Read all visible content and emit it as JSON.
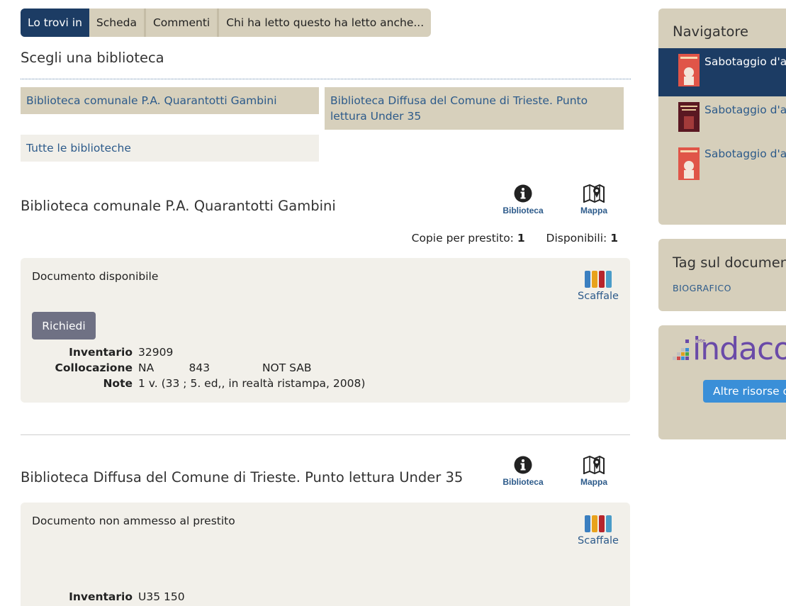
{
  "tabs": [
    {
      "label": "Lo trovi in",
      "active": true
    },
    {
      "label": "Scheda",
      "active": false
    },
    {
      "label": "Commenti",
      "active": false
    },
    {
      "label": "Chi ha letto questo ha letto anche...",
      "active": false
    }
  ],
  "choose_title": "Scegli una biblioteca",
  "library_buttons": [
    "Biblioteca comunale P.A. Quarantotti Gambini",
    "Biblioteca Diffusa del Comune di Trieste. Punto lettura Under 35",
    "Tutte le biblioteche"
  ],
  "icon_labels": {
    "library": "Biblioteca",
    "map": "Mappa",
    "shelf": "Scaffale"
  },
  "libraries": [
    {
      "name": "Biblioteca comunale P.A. Quarantotti Gambini",
      "copies_label": "Copie per prestito:",
      "copies_value": "1",
      "available_label": "Disponibili:",
      "available_value": "1",
      "status": "Documento disponibile",
      "request_label": "Richiedi",
      "details": [
        {
          "key": "Inventario",
          "value": "32909"
        },
        {
          "key": "Collocazione",
          "value": "NA          843               NOT SAB"
        },
        {
          "key": "Note",
          "value": "1 v. (33 ; 5. ed,, in realtà ristampa, 2008)"
        }
      ]
    },
    {
      "name": "Biblioteca Diffusa del Comune di Trieste. Punto lettura Under 35",
      "status": "Documento non ammesso al prestito",
      "details": [
        {
          "key": "Inventario",
          "value": "U35 150"
        }
      ]
    }
  ],
  "sidebar": {
    "navigator_title": "Navigatore",
    "navigator_items": [
      {
        "label": "Sabotaggio d'am",
        "active": true
      },
      {
        "label": "Sabotaggio d'am",
        "active": false
      },
      {
        "label": "Sabotaggio d'am",
        "active": false
      }
    ],
    "tags_title": "Tag sul documen",
    "tags": [
      "BIOGRAFICO"
    ],
    "indaco_brand": "indaco",
    "indaco_small": "rete",
    "other_resources_label": "Altre risorse d"
  },
  "colors": {
    "accent_dark": "#1c3c64",
    "panel_beige": "#d6cfbb",
    "link_blue": "#2c5a8a",
    "button_grey": "#6f7184",
    "indaco_purple": "#6a4aa8",
    "altre_blue": "#3a8fd8"
  }
}
